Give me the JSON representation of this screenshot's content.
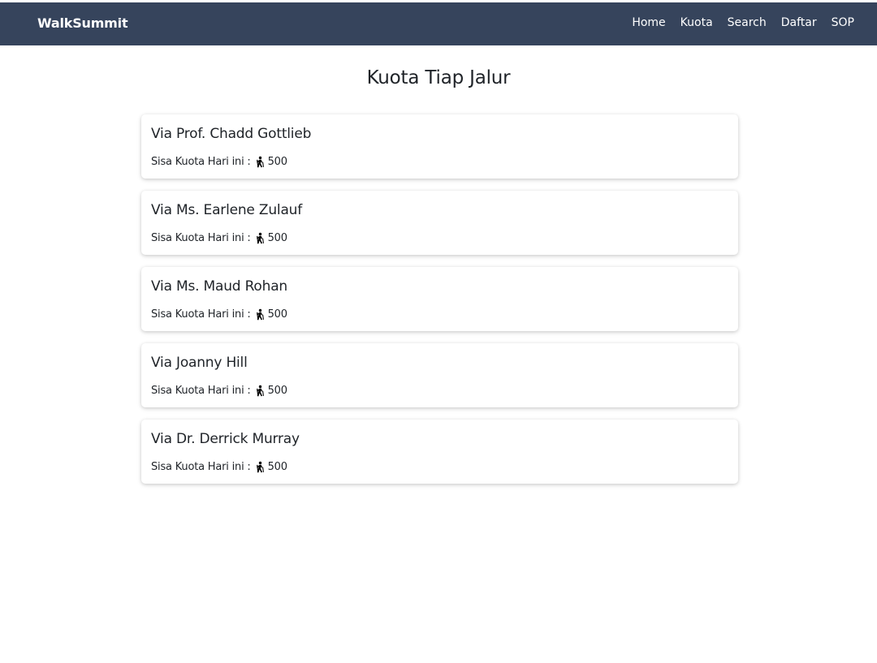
{
  "navbar": {
    "brand": "WalkSummit",
    "links": [
      {
        "label": "Home"
      },
      {
        "label": "Kuota"
      },
      {
        "label": "Search"
      },
      {
        "label": "Daftar"
      },
      {
        "label": "SOP"
      }
    ],
    "background": "#36445c"
  },
  "page": {
    "title": "Kuota Tiap Jalur"
  },
  "routes": [
    {
      "name": "Via Prof. Chadd Gottlieb",
      "quota_label": "Sisa Kuota Hari ini :",
      "icon": "hiker-icon",
      "quota": "500"
    },
    {
      "name": "Via Ms. Earlene Zulauf",
      "quota_label": "Sisa Kuota Hari ini :",
      "icon": "hiker-icon",
      "quota": "500"
    },
    {
      "name": "Via Ms. Maud Rohan",
      "quota_label": "Sisa Kuota Hari ini :",
      "icon": "hiker-icon",
      "quota": "500"
    },
    {
      "name": "Via Joanny Hill",
      "quota_label": "Sisa Kuota Hari ini :",
      "icon": "hiker-icon",
      "quota": "500"
    },
    {
      "name": "Via Dr. Derrick Murray",
      "quota_label": "Sisa Kuota Hari ini :",
      "icon": "hiker-icon",
      "quota": "500"
    }
  ]
}
